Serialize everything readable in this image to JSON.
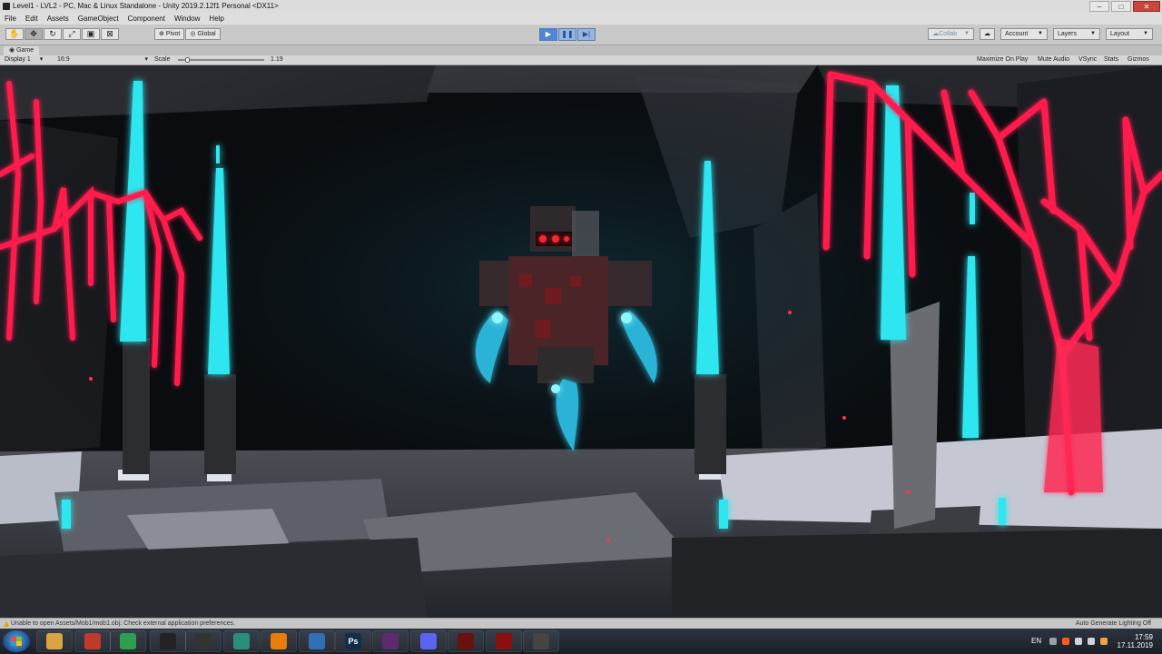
{
  "window": {
    "title": "Level1 - LVL2 - PC, Mac & Linux Standalone - Unity 2019.2.12f1 Personal <DX11>",
    "controls": {
      "minimize": "–",
      "maximize": "□",
      "close": "✕"
    }
  },
  "menu": [
    "File",
    "Edit",
    "Assets",
    "GameObject",
    "Component",
    "Window",
    "Help"
  ],
  "toolbar": {
    "tools": [
      "hand-tool",
      "move-tool",
      "rotate-tool",
      "scale-tool",
      "rect-tool",
      "transform-tool"
    ],
    "pivot_label": "Pivot",
    "global_label": "Global",
    "play_label": "▶",
    "pause_label": "❚❚",
    "step_label": "▶|",
    "collab_label": "Collab",
    "account_label": "Account",
    "layers_label": "Layers",
    "layout_label": "Layout"
  },
  "game_tab": {
    "label": "Game"
  },
  "game_bar": {
    "display": "Display 1",
    "aspect": "16:9",
    "scale_label": "Scale",
    "scale_value": "1.19",
    "scale_fraction": 0.1,
    "maximize_on_play": "Maximize On Play",
    "mute_audio": "Mute Audio",
    "vsync": "VSync",
    "stats": "Stats",
    "gizmos": "Gizmos"
  },
  "status": {
    "message": "Unable to open Assets/Mob1/mob1.obj: Check external application preferences.",
    "right": "Auto Generate Lighting Off"
  },
  "taskbar": {
    "apps": [
      {
        "name": "explorer",
        "label": "",
        "color": "#d9a441"
      },
      {
        "name": "app-red",
        "label": "",
        "color": "#c0392b"
      },
      {
        "name": "chrome",
        "label": "",
        "color": "#2e9e4f"
      },
      {
        "name": "unity-hub",
        "label": "",
        "color": "#222222"
      },
      {
        "name": "unity",
        "label": "",
        "color": "#333333"
      },
      {
        "name": "app-green",
        "label": "",
        "color": "#2a8f7a"
      },
      {
        "name": "blender",
        "label": "",
        "color": "#e87d0d"
      },
      {
        "name": "app-blue",
        "label": "",
        "color": "#2f6fb5"
      },
      {
        "name": "photoshop",
        "label": "Ps",
        "color": "#0f2e4a"
      },
      {
        "name": "app-x",
        "label": "",
        "color": "#5b2b6e"
      },
      {
        "name": "discord",
        "label": "",
        "color": "#5865f2"
      },
      {
        "name": "gpu-tool",
        "label": "",
        "color": "#6a1010"
      },
      {
        "name": "gpu-tool-2",
        "label": "",
        "color": "#8a1010"
      },
      {
        "name": "unity-active",
        "label": "",
        "color": "#444444"
      }
    ],
    "lang": "EN",
    "time": "17:59",
    "date": "17.11.2019"
  }
}
